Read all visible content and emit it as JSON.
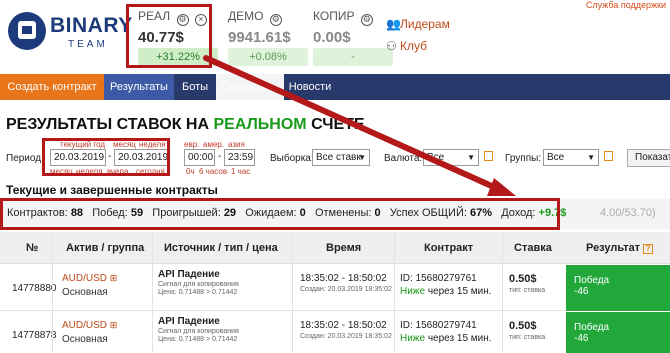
{
  "top_right_link": "Служба поддержки",
  "logo": {
    "brand": "BINARY",
    "sub": "TEAM"
  },
  "accounts": [
    {
      "name": "РЕАЛ",
      "balance": "40.77$",
      "change": "+31.22%"
    },
    {
      "name": "ДЕМО",
      "balance": "9941.61$",
      "change": "+0.08%"
    },
    {
      "name": "КОПИР",
      "balance": "0.00$",
      "change": "-"
    }
  ],
  "sidelinks": {
    "leaders": "Лидерам",
    "club": "Клуб"
  },
  "nav": {
    "create": "Создать контракт",
    "results": "Результаты",
    "bots": "Боты",
    "stats": "Статистика",
    "news": "Новости"
  },
  "title": {
    "prefix": "РЕЗУЛЬТАТЫ СТАВОК НА ",
    "highlight": "РЕАЛЬНОМ",
    "suffix": " СЧЕТЕ"
  },
  "filters": {
    "hints_top": [
      "текущий год",
      "месяц",
      "неделя"
    ],
    "hints_bottom": [
      "месяц",
      "неделя",
      "вчера",
      "сегодня"
    ],
    "period_label": "Период:",
    "date_from": "20.03.2019",
    "date_to": "20.03.2019",
    "session_hints_top": [
      "евр.",
      "амер.",
      "азия"
    ],
    "session_hints_bottom": [
      "0ч",
      "6 часов",
      "1 час"
    ],
    "time_from": "00:00",
    "time_to": "23:59",
    "selection_label": "Выборка:",
    "selection_value": "Все ставк",
    "currency_label": "Валюта:",
    "currency_value": "Все",
    "groups_label": "Группы:",
    "groups_value": "Все",
    "show_button": "Показат"
  },
  "section_title": "Текущие и завершенные контракты",
  "stats": {
    "contracts_label": "Контрактов:",
    "contracts": "88",
    "wins_label": "Побед:",
    "wins": "59",
    "losses_label": "Проигрышей:",
    "losses": "29",
    "waiting_label": "Ожидаем:",
    "waiting": "0",
    "cancelled_label": "Отменены:",
    "cancelled": "0",
    "success_label": "Успех ОБЩИЙ:",
    "success": "67%",
    "income_label": "Доход:",
    "income": "+9.7$",
    "extra": "4.00/53.70)"
  },
  "table": {
    "headers": {
      "num": "№",
      "asset": "Актив / группа",
      "source": "Источник / тип / цена",
      "time": "Время",
      "contract": "Контракт",
      "stake": "Ставка",
      "result": "Результат"
    },
    "rows": [
      {
        "id": "14778880",
        "pair": "AUD/USD",
        "group": "Основная",
        "source": "API Падение",
        "source_type": "Сигнал для копирования",
        "price": "Цена: 0.71488 > 0.71442",
        "time": "18:35:02 - 18:50:02",
        "created": "Создан: 20.03.2019 18:35:02",
        "contract_id": "ID: 15680279761",
        "contract_dir": "Ниже",
        "contract_dur": " через 15 мин.",
        "stake": "0.50$",
        "stake_type": "тип: ставка",
        "result_label": "Победа",
        "result_value": "-46"
      },
      {
        "id": "14778878",
        "pair": "AUD/USD",
        "group": "Основная",
        "source": "API Падение",
        "source_type": "Сигнал для копирования",
        "price": "Цена: 0.71488 > 0.71442",
        "time": "18:35:02 - 18:50:02",
        "created": "Создан: 20.03.2019 18:35:02",
        "contract_id": "ID: 15680279741",
        "contract_dir": "Ниже",
        "contract_dur": " через 15 мин.",
        "stake": "0.50$",
        "stake_type": "тип: ставка",
        "result_label": "Победа",
        "result_value": "-46"
      }
    ]
  }
}
